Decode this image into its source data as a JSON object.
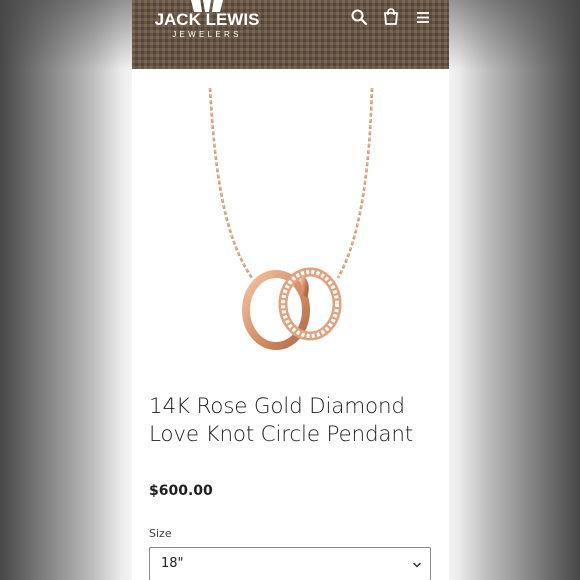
{
  "header": {
    "brand_name": "JACK LEWIS",
    "brand_sub": "JEWELERS",
    "icons": [
      "search-icon",
      "cart-icon",
      "menu-icon"
    ]
  },
  "product": {
    "image_alt": "14K rose gold love knot circle pendant on chain",
    "title": "14K Rose Gold Diamond Love Knot Circle Pendant",
    "price": "$600.00"
  },
  "size": {
    "label": "Size",
    "selected": "18\""
  },
  "colors": {
    "header_brown": "#6a5643",
    "rose_gold": "#d9936c",
    "text": "#1f1f1f"
  }
}
